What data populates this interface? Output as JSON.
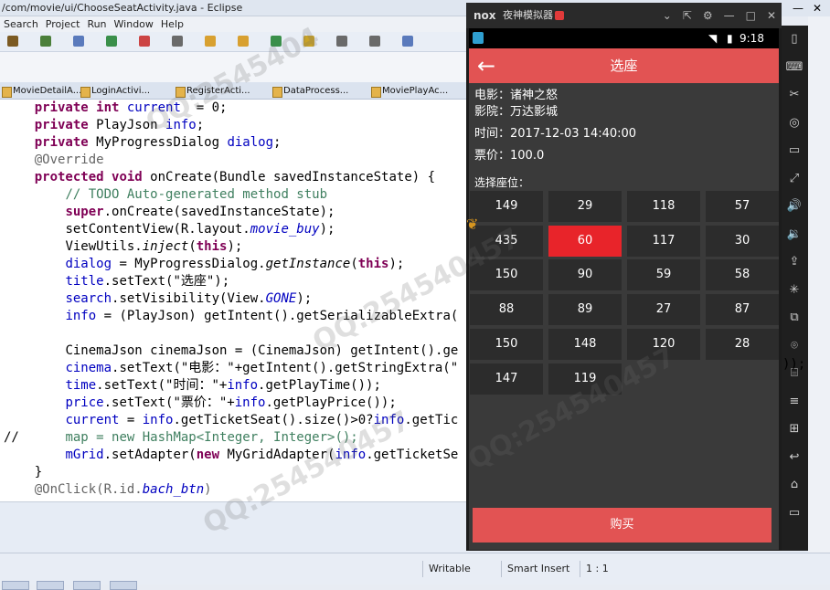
{
  "eclipse": {
    "title": "/com/movie/ui/ChooseSeatActivity.java - Eclipse",
    "menu": [
      "Search",
      "Project",
      "Run",
      "Window",
      "Help"
    ],
    "tabs": [
      "MovieDetailA...",
      "LoginActivi...",
      "RegisterActi...",
      "DataProcess...",
      "MoviePlayAc..."
    ],
    "status": {
      "writable": "Writable",
      "insert_mode": "Smart Insert",
      "position": "1 : 1"
    }
  },
  "code": {
    "lines": [
      {
        "indent": "    ",
        "parts": [
          [
            "kw",
            "private "
          ],
          [
            "kw",
            "int "
          ],
          [
            "fld",
            "current"
          ],
          [
            "",
            "  = 0;"
          ]
        ]
      },
      {
        "indent": "    ",
        "parts": [
          [
            "kw",
            "private "
          ],
          [
            "",
            "PlayJson "
          ],
          [
            "fld",
            "info"
          ],
          [
            "",
            ";"
          ]
        ]
      },
      {
        "indent": "    ",
        "parts": [
          [
            "kw",
            "private "
          ],
          [
            "",
            "MyProgressDialog "
          ],
          [
            "fld",
            "dialog"
          ],
          [
            "",
            ";"
          ]
        ]
      },
      {
        "indent": "    ",
        "parts": [
          [
            "ann",
            "@Override"
          ]
        ]
      },
      {
        "indent": "    ",
        "parts": [
          [
            "kw",
            "protected "
          ],
          [
            "kw",
            "void "
          ],
          [
            "",
            "onCreate(Bundle savedInstanceState) {"
          ]
        ]
      },
      {
        "indent": "        ",
        "parts": [
          [
            "cm",
            "// TODO Auto-generated method stub"
          ]
        ]
      },
      {
        "indent": "        ",
        "parts": [
          [
            "kw",
            "super"
          ],
          [
            "",
            ".onCreate(savedInstanceState);"
          ]
        ]
      },
      {
        "indent": "        ",
        "parts": [
          [
            "",
            "setContentView(R.layout."
          ],
          [
            "fld it",
            "movie_buy"
          ],
          [
            "",
            ");"
          ]
        ]
      },
      {
        "indent": "        ",
        "parts": [
          [
            "",
            "ViewUtils."
          ],
          [
            "it",
            "inject"
          ],
          [
            "",
            "("
          ],
          [
            "kw",
            "this"
          ],
          [
            "",
            ");"
          ]
        ]
      },
      {
        "indent": "        ",
        "parts": [
          [
            "fld",
            "dialog"
          ],
          [
            "",
            " = MyProgressDialog."
          ],
          [
            "it",
            "getInstance"
          ],
          [
            "",
            "("
          ],
          [
            "kw",
            "this"
          ],
          [
            "",
            ");"
          ]
        ]
      },
      {
        "indent": "        ",
        "parts": [
          [
            "fld",
            "title"
          ],
          [
            "",
            ".setText(\"选座\");"
          ]
        ]
      },
      {
        "indent": "        ",
        "parts": [
          [
            "fld",
            "search"
          ],
          [
            "",
            ".setVisibility(View."
          ],
          [
            "fld it",
            "GONE"
          ],
          [
            "",
            ");"
          ]
        ]
      },
      {
        "indent": "        ",
        "parts": [
          [
            "fld",
            "info"
          ],
          [
            "",
            " = (PlayJson) getIntent().getSerializableExtra("
          ]
        ]
      },
      {
        "indent": "",
        "parts": [
          [
            "",
            ""
          ]
        ]
      },
      {
        "indent": "        ",
        "parts": [
          [
            "",
            "CinemaJson cinemaJson = (CinemaJson) getIntent().ge"
          ]
        ]
      },
      {
        "indent": "        ",
        "parts": [
          [
            "fld",
            "cinema"
          ],
          [
            "",
            ".setText(\"电影：\"+getIntent().getStringExtra(\""
          ]
        ]
      },
      {
        "indent": "        ",
        "parts": [
          [
            "fld",
            "time"
          ],
          [
            "",
            ".setText(\"时间：\"+"
          ],
          [
            "fld",
            "info"
          ],
          [
            "",
            ".getPlayTime());"
          ]
        ]
      },
      {
        "indent": "        ",
        "parts": [
          [
            "fld",
            "price"
          ],
          [
            "",
            ".setText(\"票价：\"+"
          ],
          [
            "fld",
            "info"
          ],
          [
            "",
            ".getPlayPrice());"
          ]
        ]
      },
      {
        "indent": "        ",
        "parts": [
          [
            "fld",
            "current"
          ],
          [
            "",
            " = "
          ],
          [
            "fld",
            "info"
          ],
          [
            "",
            ".getTicketSeat().size()>0?"
          ],
          [
            "fld",
            "info"
          ],
          [
            "",
            ".getTic"
          ]
        ]
      },
      {
        "indent": "//      ",
        "parts": [
          [
            "cm",
            "map = new HashMap<Integer, Integer>();"
          ]
        ]
      },
      {
        "indent": "        ",
        "parts": [
          [
            "fld",
            "mGrid"
          ],
          [
            "",
            ".setAdapter("
          ],
          [
            "kw",
            "new "
          ],
          [
            "",
            "MyGridAdapter("
          ],
          [
            "fld",
            "info"
          ],
          [
            "",
            ".getTicketSe"
          ]
        ]
      },
      {
        "indent": "    ",
        "parts": [
          [
            "",
            "}"
          ]
        ]
      },
      {
        "indent": "    ",
        "parts": [
          [
            "ann",
            "@OnClick(R.id."
          ],
          [
            "fld it",
            "bach_btn"
          ],
          [
            "ann",
            ")"
          ]
        ]
      }
    ],
    "overflow_tail": "));"
  },
  "emulator": {
    "logo": "nox",
    "window_title": "夜神模拟器",
    "controls": [
      "⌄",
      "⇱",
      "⚙",
      "—",
      "□",
      "✕"
    ],
    "clock": "9:18",
    "side_icons": [
      "phone-icon",
      "keyboard-icon",
      "scissors-icon",
      "location-icon",
      "screen-icon",
      "fullscreen-icon",
      "volume-up-icon",
      "volume-down-icon",
      "apk-icon",
      "shake-icon",
      "multi-icon",
      "camera-icon",
      "macro-icon",
      "menu-icon",
      "add-icon",
      "back-icon",
      "home-icon",
      "recent-icon"
    ],
    "side_glyphs": [
      "▯",
      "⌨",
      "✂",
      "◎",
      "▭",
      "⤢",
      "🔊",
      "🔉",
      "⇪",
      "✳",
      "⧉",
      "⌾",
      "⌸",
      "≡",
      "⊞",
      "↩",
      "⌂",
      "▭"
    ]
  },
  "app": {
    "title": "选座",
    "movie": "电影：诸神之怒",
    "cinema": "影院：万达影城",
    "time": "时间：2017-12-03 14:40:00",
    "price": "票价：100.0",
    "seat_label": "选择座位：",
    "seats": [
      [
        149,
        29,
        118,
        57
      ],
      [
        435,
        60,
        117,
        30
      ],
      [
        150,
        90,
        59,
        58
      ],
      [
        88,
        89,
        27,
        87
      ],
      [
        150,
        148,
        120,
        28
      ],
      [
        147,
        119
      ]
    ],
    "selected_seat": {
      "row": 1,
      "col": 1
    },
    "buy_label": "购买"
  },
  "colors": {
    "app_red": "#e25353",
    "selected_seat": "#e8242a",
    "keyword": "#7f0055",
    "comment": "#3f7f5f",
    "field": "#0000c0"
  }
}
